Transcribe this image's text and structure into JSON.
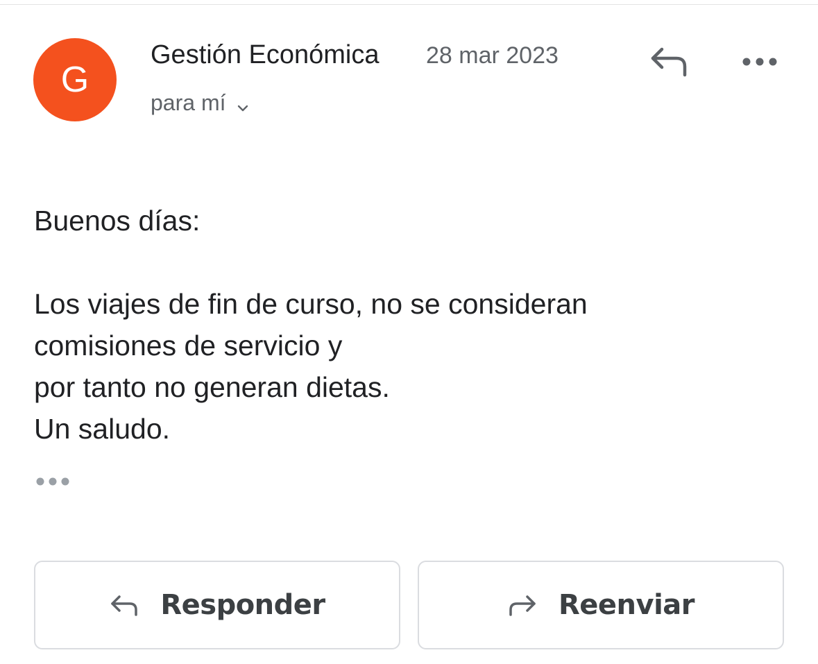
{
  "message": {
    "avatar_letter": "G",
    "sender": "Gestión Económica",
    "date": "28 mar 2023",
    "recipient": "para mí",
    "body": {
      "greeting": "Buenos días:",
      "lines": [
        "Los viajes de fin de curso, no se consideran",
        "comisiones de servicio y",
        "por tanto no generan dietas.",
        "Un saludo."
      ]
    }
  },
  "actions": {
    "reply_label": "Responder",
    "forward_label": "Reenviar"
  },
  "icons": {
    "header_reply": "reply-icon",
    "header_more": "more-horiz-icon",
    "recipient_expand": "chevron-down-icon",
    "body_more": "more-horiz-icon",
    "reply": "reply-icon",
    "forward": "forward-icon"
  },
  "colors": {
    "avatar": "#f4511e",
    "icon": "#5f6368",
    "button_border": "#dadce0"
  }
}
